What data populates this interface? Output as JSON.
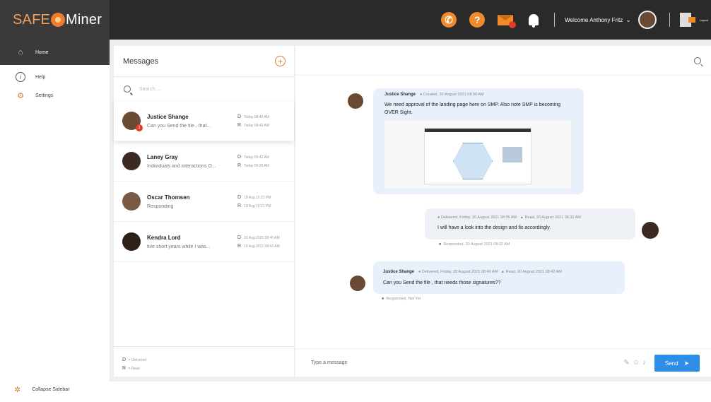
{
  "brand": {
    "safe": "SAFE",
    "miner": "Miner"
  },
  "topbar": {
    "welcome": "Welcome Anthony Fritz",
    "logout": "Logout",
    "help_glyph": "?",
    "icons": [
      "phone-icon",
      "help-icon",
      "mail-icon",
      "bell-icon",
      "logout-icon"
    ]
  },
  "sidebar": {
    "items": [
      {
        "label": "Home",
        "icon": "home-icon"
      },
      {
        "label": "Help",
        "icon": "help-icon"
      },
      {
        "label": "Settings",
        "icon": "gear-icon"
      }
    ],
    "collapse": "Collapse Sidebar"
  },
  "messages": {
    "title": "Messages",
    "add_glyph": "+",
    "search_placeholder": "Search....",
    "conversations": [
      {
        "name": "Justice Shange",
        "preview": "Can you Send the file , that...",
        "d": "Today 08:40 AM",
        "r": "Today 08:42 AM",
        "badge": "1",
        "avatar_color": "#6b4a35"
      },
      {
        "name": "Laney Gray",
        "preview": "Individuals and interactions O...",
        "d": "Today 05:42 AM",
        "r": "Today 06:20 AM",
        "badge": "",
        "avatar_color": "#3a2a22"
      },
      {
        "name": "Oscar Thomsen",
        "preview": "Responding",
        "d": "19 Aug 15:21 PM",
        "r": "19 Aug 15:21 PM",
        "badge": "",
        "avatar_color": "#7a5a44"
      },
      {
        "name": "Kendra Lord",
        "preview": "five short years while I was...",
        "d": "15 Aug 2021 08:40 AM",
        "r": "15 Aug 2021 08:42 AM",
        "badge": "",
        "avatar_color": "#2e2018"
      }
    ],
    "legend": {
      "d": "D",
      "d_text": "= Delivered",
      "r": "R",
      "r_text": "= Read"
    }
  },
  "chat": {
    "m1": {
      "sender": "Justice Shange",
      "meta": "Created, 20 August 2021 08:30 AM",
      "text": "We need approval of the landing page here on SMP. Also note SMP is becoming OVER Sight."
    },
    "m2": {
      "delivered": "Delivered, Friday, 20 August 2021 08:35 AM",
      "read": "Read, 20 August 2021 08:32 AM",
      "text": "I will have a look into the design and fix accordingly.",
      "responded": "Responded, 20 August 2021 08:32 AM"
    },
    "m3": {
      "sender": "Justice Shange",
      "delivered": "Delivered, Friday, 20 August 2021 08:40 AM",
      "read": "Read, 20 August 2021 08:42 AM",
      "text": "Can you Send the file , that needs those signatures??",
      "responded": "Responded, Not Yet"
    },
    "input_placeholder": "Type a message",
    "send": "Send"
  }
}
